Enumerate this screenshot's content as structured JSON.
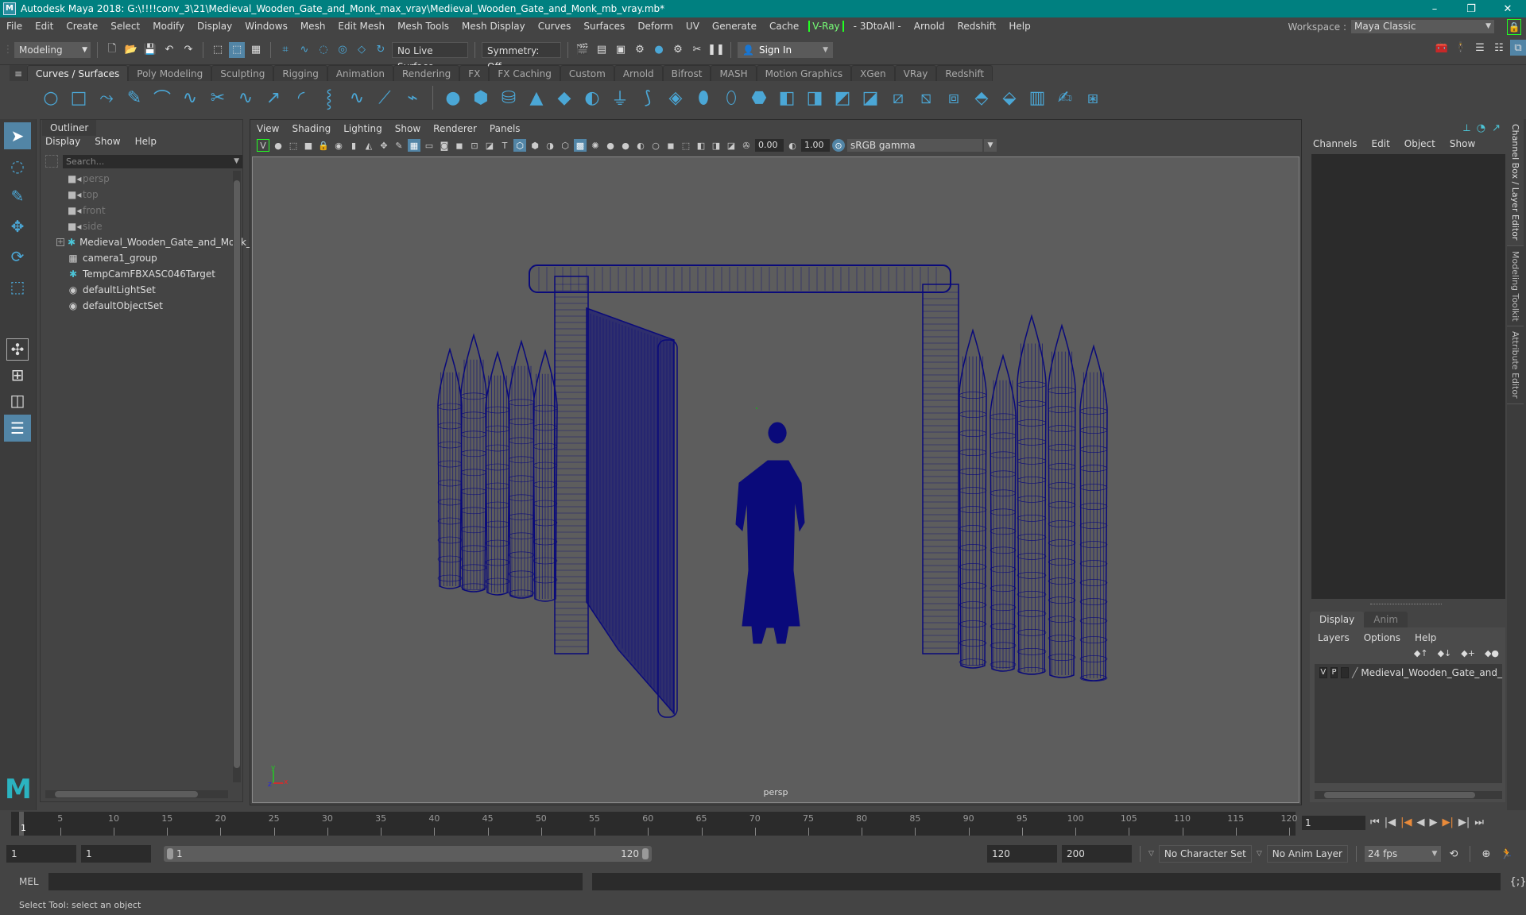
{
  "title_bar": {
    "title": "Autodesk Maya 2018: G:\\!!!!conv_3\\21\\Medieval_Wooden_Gate_and_Monk_max_vray\\Medieval_Wooden_Gate_and_Monk_mb_vray.mb*",
    "minimize": "–",
    "restore": "❐",
    "close": "✕"
  },
  "menu_bar": {
    "items": [
      "File",
      "Edit",
      "Create",
      "Select",
      "Modify",
      "Display",
      "Windows",
      "Mesh",
      "Edit Mesh",
      "Mesh Tools",
      "Mesh Display",
      "Curves",
      "Surfaces",
      "Deform",
      "UV",
      "Generate",
      "Cache",
      "V-Ray",
      "- 3DtoAll -",
      "Arnold",
      "Redshift",
      "Help"
    ],
    "workspace_label": "Workspace :",
    "workspace_value": "Maya Classic"
  },
  "status_line": {
    "mode": "Modeling",
    "live_surface": "No Live Surface",
    "symmetry": "Symmetry: Off",
    "sign_in": "Sign In"
  },
  "shelf": {
    "tabs": [
      "Curves / Surfaces",
      "Poly Modeling",
      "Sculpting",
      "Rigging",
      "Animation",
      "Rendering",
      "FX",
      "FX Caching",
      "Custom",
      "Arnold",
      "Bifrost",
      "MASH",
      "Motion Graphics",
      "XGen",
      "VRay",
      "Redshift"
    ],
    "active_tab": "Curves / Surfaces"
  },
  "outliner": {
    "tab": "Outliner",
    "menu": [
      "Display",
      "Show",
      "Help"
    ],
    "search_placeholder": "Search...",
    "items": [
      {
        "label": "persp",
        "icon": "camera-icon",
        "dim": true
      },
      {
        "label": "top",
        "icon": "camera-icon",
        "dim": true
      },
      {
        "label": "front",
        "icon": "camera-icon",
        "dim": true
      },
      {
        "label": "side",
        "icon": "camera-icon",
        "dim": true
      },
      {
        "label": "Medieval_Wooden_Gate_and_Monk_",
        "icon": "transform-icon",
        "expandable": true
      },
      {
        "label": "camera1_group",
        "icon": "group-icon"
      },
      {
        "label": "TempCamFBXASC046Target",
        "icon": "transform-icon"
      },
      {
        "label": "defaultLightSet",
        "icon": "set-icon"
      },
      {
        "label": "defaultObjectSet",
        "icon": "set-icon"
      }
    ]
  },
  "viewport": {
    "menu": [
      "View",
      "Shading",
      "Lighting",
      "Show",
      "Renderer",
      "Panels"
    ],
    "exposure": "0.00",
    "gamma": "1.00",
    "color_space": "sRGB gamma",
    "camera_label": "persp",
    "wire_color": "#0a0a7a",
    "bg_color": "#5d5d5d"
  },
  "channel_box": {
    "menu": [
      "Channels",
      "Edit",
      "Object",
      "Show"
    ]
  },
  "side_tabs": [
    "Channel Box / Layer Editor",
    "Modeling Toolkit",
    "Attribute Editor"
  ],
  "layer_editor": {
    "tabs": [
      "Display",
      "Anim"
    ],
    "menu": [
      "Layers",
      "Options",
      "Help"
    ],
    "layers": [
      {
        "v": "V",
        "p": "P",
        "name": "Medieval_Wooden_Gate_and_"
      }
    ]
  },
  "timeline": {
    "ticks": [
      5,
      10,
      15,
      20,
      25,
      30,
      35,
      40,
      45,
      50,
      55,
      60,
      65,
      70,
      75,
      80,
      85,
      90,
      95,
      100,
      105,
      110,
      115,
      120
    ],
    "start": 1,
    "end": 120,
    "current_frame": "1"
  },
  "range": {
    "start": "1",
    "anim_start": "1",
    "slider_start": "1",
    "slider_end": "120",
    "end": "120",
    "anim_end": "200",
    "character_set": "No Character Set",
    "anim_layer": "No Anim Layer",
    "fps": "24 fps"
  },
  "command_line": {
    "label": "MEL"
  },
  "help_line": {
    "text": "Select Tool: select an object"
  }
}
